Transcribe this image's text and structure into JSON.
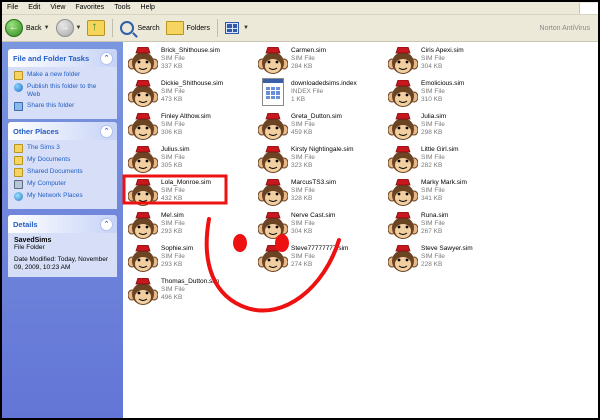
{
  "menu": [
    "File",
    "Edit",
    "View",
    "Favorites",
    "Tools",
    "Help"
  ],
  "toolbar": {
    "back_label": "Back",
    "search_label": "Search",
    "folders_label": "Folders",
    "norton_label": "Norton AntiVirus"
  },
  "tasks_panel": {
    "title": "File and Folder Tasks",
    "items": [
      "Make a new folder",
      "Publish this folder to the Web",
      "Share this folder"
    ]
  },
  "places_panel": {
    "title": "Other Places",
    "items": [
      "The Sims 3",
      "My Documents",
      "Shared Documents",
      "My Computer",
      "My Network Places"
    ]
  },
  "details_panel": {
    "title": "Details",
    "name": "SavedSims",
    "kind": "File Folder",
    "modified_label": "Date Modified: Today, November 09, 2009, 10:23 AM"
  },
  "files": [
    {
      "name": "Brick_Shithouse.sim",
      "type": "SIM File",
      "size": "337 KB"
    },
    {
      "name": "Carmen.sim",
      "type": "SIM File",
      "size": "284 KB"
    },
    {
      "name": "Ciris Apexi.sim",
      "type": "SIM File",
      "size": "304 KB"
    },
    {
      "name": "Dickie_Shithouse.sim",
      "type": "SIM File",
      "size": "473 KB"
    },
    {
      "name": "downloadedsims.index",
      "type": "INDEX File",
      "size": "1 KB"
    },
    {
      "name": "Emolicious.sim",
      "type": "SIM File",
      "size": "310 KB"
    },
    {
      "name": "Finley Althow.sim",
      "type": "SIM File",
      "size": "306 KB"
    },
    {
      "name": "Greta_Dutton.sim",
      "type": "SIM File",
      "size": "459 KB"
    },
    {
      "name": "Julia.sim",
      "type": "SIM File",
      "size": "298 KB"
    },
    {
      "name": "Julius.sim",
      "type": "SIM File",
      "size": "305 KB"
    },
    {
      "name": "Kirsty Nightingale.sim",
      "type": "SIM File",
      "size": "323 KB"
    },
    {
      "name": "Little Girl.sim",
      "type": "SIM File",
      "size": "282 KB"
    },
    {
      "name": "Lola_Monroe.sim",
      "type": "SIM File",
      "size": "432 KB"
    },
    {
      "name": "MarcusTS3.sim",
      "type": "SIM File",
      "size": "328 KB"
    },
    {
      "name": "Marky Mark.sim",
      "type": "SIM File",
      "size": "341 KB"
    },
    {
      "name": "Me!.sim",
      "type": "SIM File",
      "size": "293 KB"
    },
    {
      "name": "Nerve Cast.sim",
      "type": "SIM File",
      "size": "304 KB"
    },
    {
      "name": "Runa.sim",
      "type": "SIM File",
      "size": "267 KB"
    },
    {
      "name": "Sophie.sim",
      "type": "SIM File",
      "size": "293 KB"
    },
    {
      "name": "Steve77777777.sim",
      "type": "SIM File",
      "size": "274 KB"
    },
    {
      "name": "Steve Sawyer.sim",
      "type": "SIM File",
      "size": "228 KB"
    },
    {
      "name": "Thomas_Dutton.sim",
      "type": "SIM File",
      "size": "496 KB"
    }
  ],
  "colors": {
    "annotation_red": "#ee1111",
    "taskpane_blue": "#6f88dc",
    "link_blue": "#215dc6"
  }
}
